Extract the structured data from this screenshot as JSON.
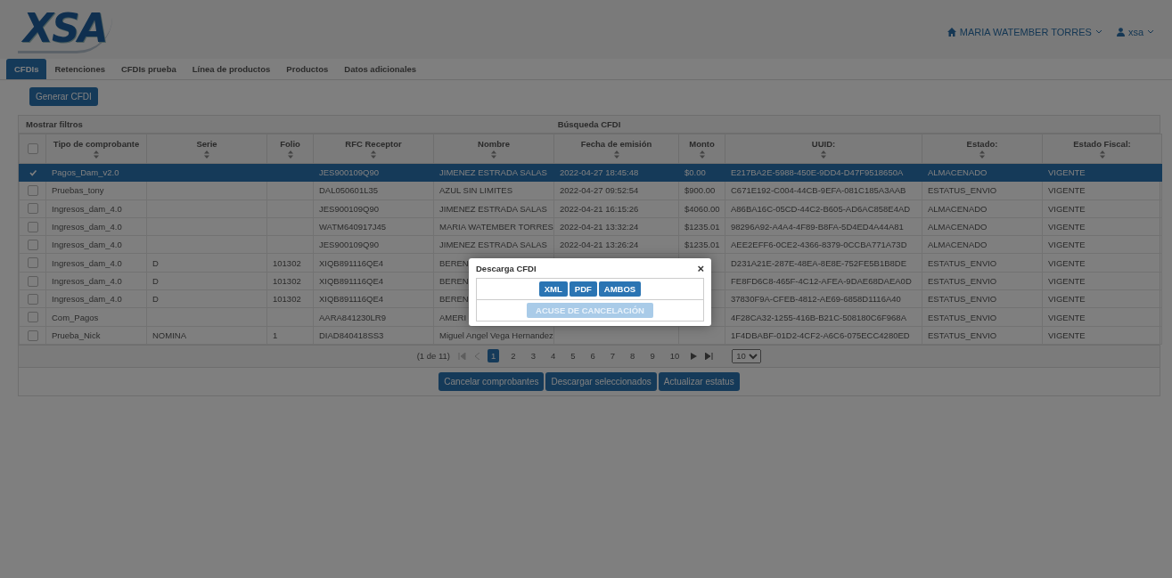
{
  "header": {
    "logo": "XSA",
    "company_menu": "MARIA WATEMBER TORRES",
    "user_menu": "xsa"
  },
  "tabs": [
    {
      "label": "CFDIs",
      "selected": true
    },
    {
      "label": "Retenciones",
      "selected": false
    },
    {
      "label": "CFDIs prueba",
      "selected": false
    },
    {
      "label": "Línea de productos",
      "selected": false
    },
    {
      "label": "Productos",
      "selected": false
    },
    {
      "label": "Datos adicionales",
      "selected": false
    }
  ],
  "generate_button": "Generar CFDI",
  "table": {
    "all_selected": false,
    "filters_toggle": "Mostrar filtros",
    "title": "Búsqueda CFDI",
    "columns": [
      "Tipo de comprobante",
      "Serie",
      "Folio",
      "RFC Receptor",
      "Nombre",
      "Fecha de emisión",
      "Monto",
      "UUID:",
      "Estado:",
      "Estado Fiscal:"
    ],
    "rows": [
      {
        "selected": true,
        "cells": [
          "Pagos_Dam_v2.0",
          "",
          "",
          "JES900109Q90",
          "JIMENEZ ESTRADA SALAS",
          "2022-04-27 18:45:48",
          "$0.00",
          "E217BA2E-5988-450E-9DD4-D47F9518650A",
          "ALMACENADO",
          "VIGENTE"
        ]
      },
      {
        "selected": false,
        "cells": [
          "Pruebas_tony",
          "",
          "",
          "DAL050601L35",
          "AZUL SIN LIMITES",
          "2022-04-27 09:52:54",
          "$900.00",
          "C671E192-C004-44CB-9EFA-081C185A3AAB",
          "ESTATUS_ENVIO",
          "VIGENTE"
        ]
      },
      {
        "selected": false,
        "cells": [
          "Ingresos_dam_4.0",
          "",
          "",
          "JES900109Q90",
          "JIMENEZ ESTRADA SALAS",
          "2022-04-21 16:15:26",
          "$4060.00",
          "A86BA16C-05CD-44C2-B605-AD6AC858E4AD",
          "ALMACENADO",
          "VIGENTE"
        ]
      },
      {
        "selected": false,
        "cells": [
          "Ingresos_dam_4.0",
          "",
          "",
          "WATM640917J45",
          "MARIA WATEMBER TORRES",
          "2022-04-21 13:32:24",
          "$1235.01",
          "98296A92-A4A4-4F89-B8FA-5D4ED4A44A81",
          "ALMACENADO",
          "VIGENTE"
        ]
      },
      {
        "selected": false,
        "cells": [
          "Ingresos_dam_4.0",
          "",
          "",
          "JES900109Q90",
          "JIMENEZ ESTRADA SALAS",
          "2022-04-21 13:26:24",
          "$1235.01",
          "AEE2EFF6-0CE2-4366-8379-0CCBA771A73D",
          "ALMACENADO",
          "VIGENTE"
        ]
      },
      {
        "selected": false,
        "cells": [
          "Ingresos_dam_4.0",
          "D",
          "101302",
          "XIQB891116QE4",
          "BEREN",
          "",
          "",
          "D231A21E-287E-48EA-8E8E-752FE5B1B8DE",
          "ESTATUS_ENVIO",
          "VIGENTE"
        ]
      },
      {
        "selected": false,
        "cells": [
          "Ingresos_dam_4.0",
          "D",
          "101302",
          "XIQB891116QE4",
          "BEREN",
          "",
          "",
          "FE8FD6C8-465F-4C12-AFEA-9DAE68DAEA0D",
          "ESTATUS_ENVIO",
          "VIGENTE"
        ]
      },
      {
        "selected": false,
        "cells": [
          "Ingresos_dam_4.0",
          "D",
          "101302",
          "XIQB891116QE4",
          "BEREN",
          "",
          "",
          "37830F9A-CFEB-4812-AE69-6858D1116A40",
          "ESTATUS_ENVIO",
          "VIGENTE"
        ]
      },
      {
        "selected": false,
        "cells": [
          "Com_Pagos",
          "",
          "",
          "AARA841230LR9",
          "AMERI",
          "",
          "",
          "4F28CA32-1255-416B-B21C-508180C6F968A",
          "ESTATUS_ENVIO",
          "VIGENTE"
        ]
      },
      {
        "selected": false,
        "cells": [
          "Prueba_Nick",
          "NOMINA",
          "1",
          "DIAD840418SS3",
          "Miguel Angel Vega Hernandez",
          "",
          "",
          "1F4DBABF-01D2-4CF2-A6C6-075ECC4280ED",
          "ESTATUS_ENVIO",
          "VIGENTE"
        ]
      }
    ]
  },
  "pagination": {
    "summary": "(1 de 11)",
    "pages": [
      {
        "label": "1",
        "selected": true
      },
      {
        "label": "2",
        "selected": false
      },
      {
        "label": "3",
        "selected": false
      },
      {
        "label": "4",
        "selected": false
      },
      {
        "label": "5",
        "selected": false
      },
      {
        "label": "6",
        "selected": false
      },
      {
        "label": "7",
        "selected": false
      },
      {
        "label": "8",
        "selected": false
      },
      {
        "label": "9",
        "selected": false
      },
      {
        "label": "10",
        "selected": false
      }
    ],
    "page_size": "10"
  },
  "actions": [
    "Cancelar comprobantes",
    "Descargar seleccionados",
    "Actualizar estatus"
  ],
  "modal": {
    "title": "Descarga CFDI",
    "close": "×",
    "buttons": [
      "XML",
      "PDF",
      "AMBOS"
    ],
    "ack_button": {
      "label": "ACUSE DE CANCELACIÓN",
      "disabled": true
    }
  }
}
